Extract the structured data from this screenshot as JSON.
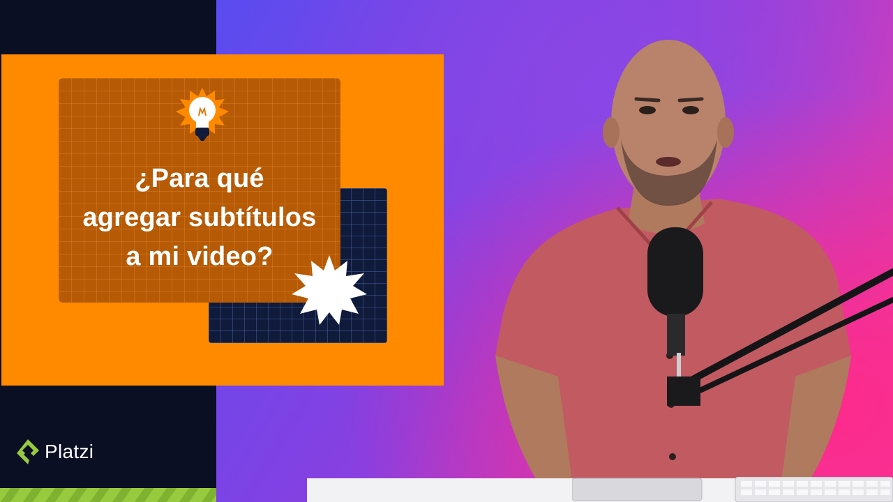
{
  "title_lines": [
    "¿Para qué",
    "agregar subtítulos",
    "a mi video?"
  ],
  "brand": {
    "name": "Platzi"
  },
  "icons": [
    "lightbulb-icon",
    "starburst-icon",
    "platzi-logo-icon"
  ],
  "colors": {
    "orange": "#ff8a00",
    "brown": "#b65a05",
    "navy": "#101a3a",
    "dark_panel": "#0b0f24",
    "brand_green": "#98ca3f",
    "shirt": "#c25a62"
  }
}
